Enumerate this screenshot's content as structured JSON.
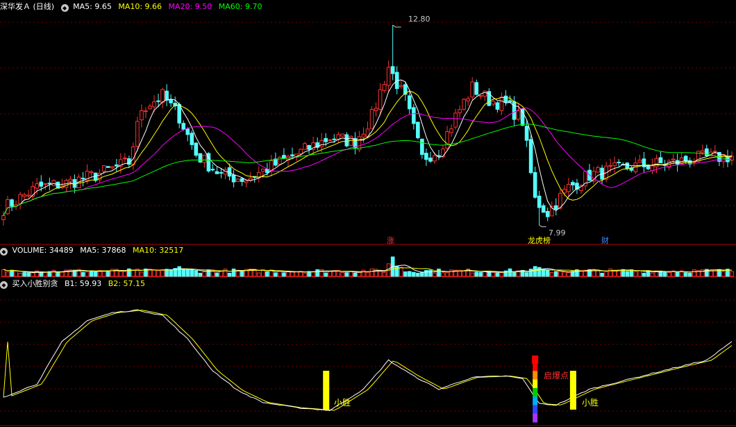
{
  "price_panel": {
    "title": "深华发Ａ (日线)",
    "indicators": [
      {
        "label": "MA5:",
        "value": "9.65",
        "color": "#ffffff"
      },
      {
        "label": "MA10:",
        "value": "9.66",
        "color": "#ffff00"
      },
      {
        "label": "MA20:",
        "value": "9.50",
        "color": "#ff00ff"
      },
      {
        "label": "MA60:",
        "value": "9.70",
        "color": "#00ff00"
      }
    ],
    "high_label": "12.80",
    "low_label": "7.99",
    "markers": [
      {
        "text": "涨",
        "color": "#ff3030"
      },
      {
        "text": "龙虎榜",
        "color": "#ffff00"
      },
      {
        "text": "财",
        "color": "#3b8cff"
      }
    ]
  },
  "volume_panel": {
    "items": [
      {
        "label": "VOLUME:",
        "value": "34489",
        "color": "#ffffff"
      },
      {
        "label": "MA5:",
        "value": "37868",
        "color": "#ffffff"
      },
      {
        "label": "MA10:",
        "value": "32517",
        "color": "#ffff00"
      }
    ]
  },
  "indicator_panel": {
    "name": "买入小胜别贪",
    "items": [
      {
        "label": "B1:",
        "value": "59.93",
        "color": "#ffffff"
      },
      {
        "label": "B2:",
        "value": "57.15",
        "color": "#ffff00"
      }
    ],
    "signals": [
      {
        "text": "小胜",
        "color": "#ffff00"
      },
      {
        "text": "启爆点",
        "color": "#ff3030"
      },
      {
        "text": "小胜",
        "color": "#ffff00"
      }
    ]
  },
  "chart_data": {
    "type": "candlestick",
    "price": {
      "ylim": [
        7.6,
        13.1
      ],
      "high_marker": 12.8,
      "low_marker": 7.99,
      "ma_levels_last": {
        "MA5": 9.65,
        "MA10": 9.66,
        "MA20": 9.5,
        "MA60": 9.7
      },
      "waypoints": [
        [
          0,
          8.4
        ],
        [
          8,
          8.9
        ],
        [
          15,
          9.0
        ],
        [
          22,
          9.2
        ],
        [
          30,
          9.5
        ],
        [
          33,
          10.8
        ],
        [
          38,
          11.1
        ],
        [
          42,
          10.6
        ],
        [
          46,
          9.7
        ],
        [
          52,
          9.2
        ],
        [
          58,
          9.1
        ],
        [
          64,
          9.4
        ],
        [
          70,
          9.7
        ],
        [
          78,
          10.1
        ],
        [
          84,
          10.0
        ],
        [
          88,
          10.6
        ],
        [
          92,
          11.8
        ],
        [
          96,
          11.0
        ],
        [
          100,
          9.6
        ],
        [
          104,
          9.8
        ],
        [
          108,
          10.6
        ],
        [
          112,
          11.3
        ],
        [
          116,
          11.0
        ],
        [
          120,
          10.9
        ],
        [
          124,
          10.5
        ],
        [
          127,
          8.6
        ],
        [
          130,
          8.3
        ],
        [
          135,
          8.9
        ],
        [
          140,
          9.2
        ],
        [
          145,
          9.3
        ],
        [
          150,
          9.4
        ],
        [
          155,
          9.45
        ],
        [
          160,
          9.5
        ],
        [
          166,
          9.6
        ],
        [
          174,
          9.65
        ]
      ]
    },
    "volume": {
      "last": 34489,
      "ma5": 37868,
      "ma10": 32517,
      "spikes": [
        [
          40,
          1.7
        ],
        [
          41,
          1.5
        ],
        [
          42,
          1.9
        ],
        [
          92,
          2.5
        ],
        [
          93,
          3.1
        ],
        [
          94,
          2.3
        ],
        [
          95,
          1.8
        ],
        [
          127,
          1.6
        ],
        [
          128,
          1.4
        ]
      ]
    },
    "oscillator": {
      "ylim": [
        0,
        100
      ],
      "B1_last": 59.93,
      "B2_last": 57.15,
      "waypoints": [
        [
          0,
          20
        ],
        [
          8,
          30
        ],
        [
          14,
          62
        ],
        [
          20,
          78
        ],
        [
          26,
          84
        ],
        [
          32,
          86
        ],
        [
          38,
          82
        ],
        [
          44,
          64
        ],
        [
          50,
          40
        ],
        [
          56,
          25
        ],
        [
          62,
          16
        ],
        [
          70,
          12
        ],
        [
          78,
          10
        ],
        [
          86,
          26
        ],
        [
          92,
          48
        ],
        [
          98,
          36
        ],
        [
          104,
          26
        ],
        [
          112,
          35
        ],
        [
          120,
          36
        ],
        [
          124,
          34
        ],
        [
          128,
          15
        ],
        [
          132,
          14
        ],
        [
          140,
          26
        ],
        [
          150,
          34
        ],
        [
          160,
          42
        ],
        [
          168,
          48
        ],
        [
          174,
          62
        ]
      ],
      "signals": [
        {
          "index": 77,
          "type": "小胜"
        },
        {
          "index": 127,
          "type": "启爆点"
        },
        {
          "index": 136,
          "type": "小胜"
        }
      ]
    }
  }
}
